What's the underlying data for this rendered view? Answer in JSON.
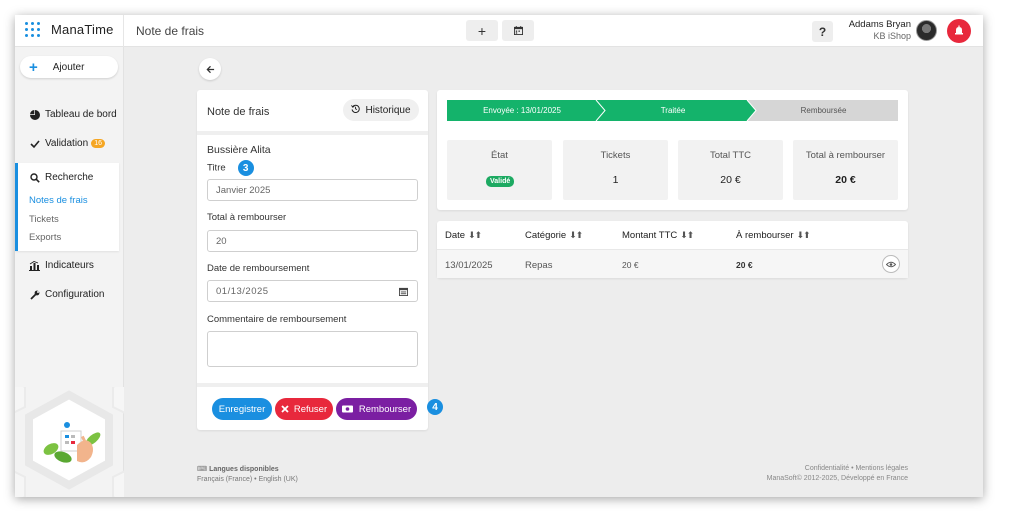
{
  "app": {
    "name": "ManaTime",
    "page_title": "Note de frais"
  },
  "toolbar": {
    "add_icon": "plus-icon",
    "calendar_icon": "calendar-icon",
    "help_label": "?"
  },
  "user": {
    "name": "Addams Bryan",
    "company": "KB iShop"
  },
  "sidebar": {
    "add_label": "Ajouter",
    "items": [
      {
        "label": "Tableau de bord",
        "icon": "pie-chart-icon"
      },
      {
        "label": "Validation",
        "icon": "check-icon",
        "badge": "16"
      },
      {
        "label": "Recherche",
        "icon": "search-icon"
      },
      {
        "label": "Indicateurs",
        "icon": "bar-chart-icon"
      },
      {
        "label": "Configuration",
        "icon": "wrench-icon"
      }
    ],
    "sub_items": [
      {
        "label": "Notes de frais",
        "active": true
      },
      {
        "label": "Tickets",
        "active": false
      },
      {
        "label": "Exports",
        "active": false
      }
    ]
  },
  "form": {
    "title": "Note de frais",
    "history_label": "Historique",
    "person": "Bussière Alita",
    "title_label": "Titre",
    "title_step": "3",
    "title_value": "Janvier 2025",
    "total_label": "Total à rembourser",
    "total_value": "20",
    "date_label": "Date de remboursement",
    "date_value": "01/13/2025",
    "comment_label": "Commentaire de remboursement",
    "comment_value": "",
    "save_label": "Enregistrer",
    "refuse_label": "Refuser",
    "refund_label": "Rembourser",
    "action_step": "4"
  },
  "status": {
    "steps": [
      "Envoyée : 13/01/2025",
      "Traitée",
      "Remboursée"
    ],
    "stats": [
      {
        "label": "État",
        "value": "Validé"
      },
      {
        "label": "Tickets",
        "value": "1"
      },
      {
        "label": "Total TTC",
        "value": "20 €"
      },
      {
        "label": "Total à rembourser",
        "value": "20 €"
      }
    ]
  },
  "table": {
    "headers": [
      "Date",
      "Catégorie",
      "Montant TTC",
      "À rembourser"
    ],
    "rows": [
      {
        "date": "13/01/2025",
        "category": "Repas",
        "amount": "20 €",
        "refund": "20 €"
      }
    ]
  },
  "footer": {
    "languages_title": "Langues disponibles",
    "languages": "Français (France) • English (UK)",
    "links": "Confidentialité • Mentions légales",
    "copyright": "ManaSoft© 2012-2025, Développé en France"
  },
  "colors": {
    "accent": "#1a8fe0",
    "success": "#1daa62",
    "danger": "#e8283c",
    "purple": "#7b1fa2",
    "warning": "#f5a623"
  }
}
